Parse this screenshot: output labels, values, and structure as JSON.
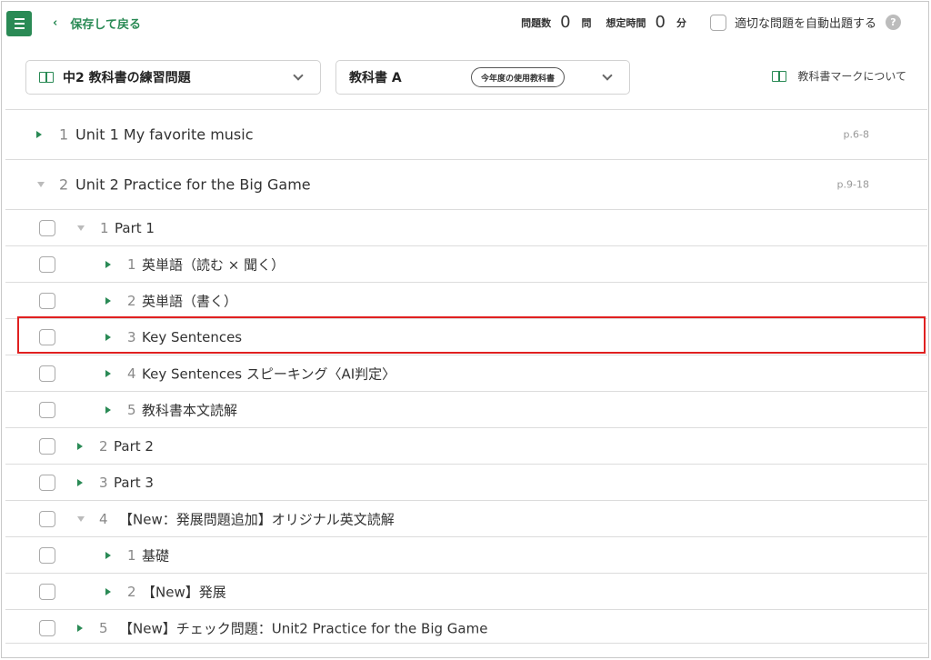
{
  "header": {
    "back_label": "保存して戻る",
    "question_count_label": "問題数",
    "question_count": "0",
    "question_unit": "問",
    "time_label": "想定時間",
    "time_value": "0",
    "time_unit": "分",
    "auto_select_label": "適切な問題を自動出題する",
    "help_glyph": "?"
  },
  "selectors": {
    "textbook_set": "中2 教科書の練習問題",
    "textbook": "教科書 A",
    "textbook_badge": "今年度の使用教科書",
    "mark_info": "教科書マークについて"
  },
  "colors": {
    "accent": "#2a8a55",
    "highlight": "#e02020"
  },
  "rows": [
    {
      "num": "1",
      "title": "Unit 1  My favorite music",
      "page": "p.6-8"
    },
    {
      "num": "2",
      "title": "Unit 2  Practice for the Big Game",
      "page": "p.9-18"
    },
    {
      "num": "1",
      "title": "Part 1"
    },
    {
      "num": "1",
      "title": "英単語（読む × 聞く）"
    },
    {
      "num": "2",
      "title": "英単語（書く）"
    },
    {
      "num": "3",
      "title": "Key Sentences"
    },
    {
      "num": "4",
      "title": "Key Sentences スピーキング〈AI判定〉"
    },
    {
      "num": "5",
      "title": "教科書本文読解"
    },
    {
      "num": "2",
      "title": "Part 2"
    },
    {
      "num": "3",
      "title": "Part 3"
    },
    {
      "num": "4",
      "title": "【New：発展問題追加】オリジナル英文読解"
    },
    {
      "num": "1",
      "title": "基礎"
    },
    {
      "num": "2",
      "title": "【New】発展"
    },
    {
      "num": "5",
      "title": "【New】チェック問題：Unit2 Practice for the Big Game"
    }
  ]
}
